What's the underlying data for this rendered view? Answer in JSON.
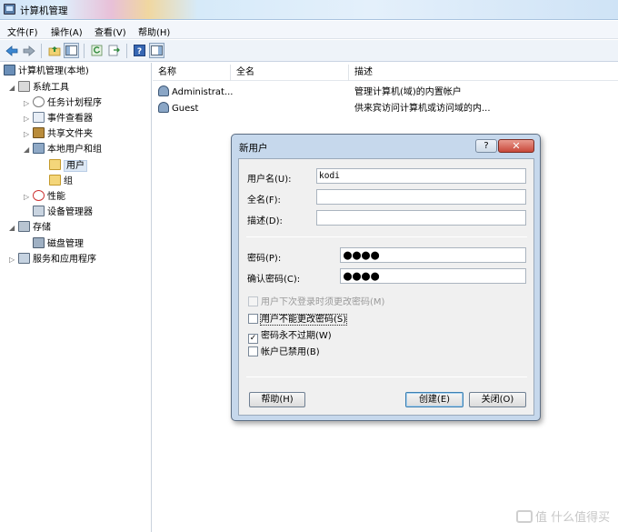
{
  "window": {
    "title": "计算机管理"
  },
  "menu": [
    "文件(F)",
    "操作(A)",
    "查看(V)",
    "帮助(H)"
  ],
  "toolbar": {
    "icons": [
      "back-arrow-icon",
      "forward-arrow-icon",
      "up-folder-icon",
      "show-hide-tree-icon",
      "refresh-icon",
      "export-list-icon",
      "help-icon",
      "properties-icon"
    ]
  },
  "tree": {
    "root": "计算机管理(本地)",
    "system_tools": "系统工具",
    "task_scheduler": "任务计划程序",
    "event_viewer": "事件查看器",
    "shared_folders": "共享文件夹",
    "local_users": "本地用户和组",
    "users": "用户",
    "groups": "组",
    "performance": "性能",
    "device_manager": "设备管理器",
    "storage": "存储",
    "disk_management": "磁盘管理",
    "services": "服务和应用程序"
  },
  "list": {
    "columns": [
      "名称",
      "全名",
      "描述"
    ],
    "rows": [
      {
        "name": "Administrat...",
        "fullname": "",
        "description": "管理计算机(域)的内置帐户"
      },
      {
        "name": "Guest",
        "fullname": "",
        "description": "供来宾访问计算机或访问域的内..."
      }
    ]
  },
  "dialog": {
    "title": "新用户",
    "help_button": "?",
    "close_button": "✕",
    "username_label": "用户名(U):",
    "username_value": "kodi",
    "fullname_label": "全名(F):",
    "fullname_value": "",
    "description_label": "描述(D):",
    "description_value": "",
    "password_label": "密码(P):",
    "password_value": "●●●●",
    "confirm_label": "确认密码(C):",
    "confirm_value": "●●●●",
    "checkboxes": {
      "must_change": {
        "label": "用户下次登录时须更改密码(M)",
        "checked": false,
        "enabled": false
      },
      "cannot_change": {
        "label": "用户不能更改密码(S)",
        "checked": false,
        "enabled": true
      },
      "never_expires": {
        "label": "密码永不过期(W)",
        "checked": true,
        "enabled": true
      },
      "disabled": {
        "label": "帐户已禁用(B)",
        "checked": false,
        "enabled": true
      }
    },
    "help_btn": "帮助(H)",
    "create_btn": "创建(E)",
    "close_btn": "关闭(O)"
  },
  "watermark": "值 什么值得买"
}
